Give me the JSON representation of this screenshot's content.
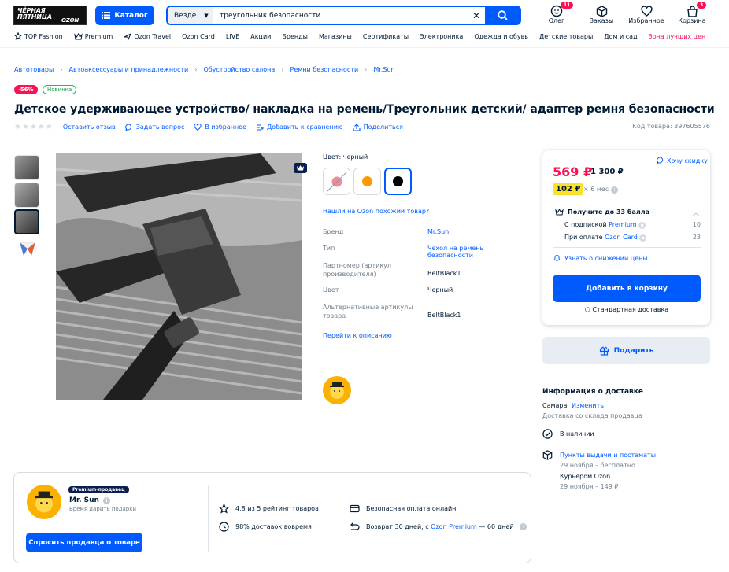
{
  "header": {
    "logo_line1": "ЧЁРНАЯ",
    "logo_line2": "ПЯТНИЦА",
    "logo_line3": "OZON",
    "catalog_label": "Каталог",
    "search_scope": "Везде",
    "search_query": "треугольник безопасности",
    "user_label": "Олег",
    "user_badge": "11",
    "orders_label": "Заказы",
    "favorites_label": "Избранное",
    "cart_label": "Корзина",
    "cart_badge": "3"
  },
  "topnav": [
    "TOP Fashion",
    "Premium",
    "Ozon Travel",
    "Ozon Card",
    "LIVE",
    "Акции",
    "Бренды",
    "Магазины",
    "Сертификаты",
    "Электроника",
    "Одежда и обувь",
    "Детские товары",
    "Дом и сад",
    "Зона лучших цен"
  ],
  "breadcrumbs": [
    "Автотовары",
    "Автоаксессуары и принадлежности",
    "Обустройство салона",
    "Ремни безопасности",
    "Mr.Sun"
  ],
  "chips": {
    "sale": "-56%",
    "new": "Новинка"
  },
  "product": {
    "title": "Детское удерживающее устройство/ накладка на ремень/Треугольник детский/ адаптер ремня безопасности",
    "code": "Код товара: 397605576",
    "actions": {
      "review": "Оставить отзыв",
      "question": "Задать вопрос",
      "favorite": "В избранное",
      "compare": "Добавить к сравнению",
      "share": "Поделиться"
    }
  },
  "options": {
    "color_label": "Цвет: черный",
    "similar_link": "Нашли на Ozon похожий товар?",
    "goto_description": "Перейти к описанию"
  },
  "specs": [
    {
      "key": "Бренд",
      "value": "Mr.Sun",
      "link": true
    },
    {
      "key": "Тип",
      "value": "Чехол на ремень безопасности",
      "link": true
    },
    {
      "key": "Партномер (артикул производителя)",
      "value": "BeltBlack1",
      "link": false
    },
    {
      "key": "Цвет",
      "value": "Черный",
      "link": false
    },
    {
      "key": "Альтернативные артикулы товара",
      "value": "BeltBlack1",
      "link": false
    }
  ],
  "price": {
    "current": "569 ₽",
    "old": "1 300 ₽",
    "want_discount": "Хочу скидку!",
    "installment": "102 ₽",
    "installment_terms": "× 6 мес",
    "points_title": "Получите до 33 балла",
    "points": [
      {
        "prefix": "С подпиской ",
        "link": "Premium",
        "value": "10"
      },
      {
        "prefix": "При оплате ",
        "link": "Ozon Card",
        "value": "23"
      }
    ],
    "notify": "Узнать о снижении цены",
    "cart_button": "Добавить в корзину",
    "delivery_type": "Стандартная доставка",
    "gift_button": "Подарить"
  },
  "delivery": {
    "title": "Информация о доставке",
    "city": "Самара",
    "change": "Изменить",
    "warehouse": "Доставка со склада продавца",
    "in_stock": "В наличии",
    "pickup_link": "Пункты выдачи и постаматы",
    "pickup_date": "29 ноября – бесплатно",
    "courier": "Курьером Ozon",
    "courier_date": "29 ноября – 149 ₽"
  },
  "seller": {
    "premium_badge": "Premium-продавец",
    "name": "Mr. Sun",
    "slogan": "Время дарить подарки",
    "ask_button": "Спросить продавца о товаре",
    "rating": "4,8 из 5 рейтинг товаров",
    "on_time": "98% доставок вовремя",
    "safe_payment": "Безопасная оплата онлайн",
    "return_prefix": "Возврат 30 дней, с ",
    "return_link": "Ozon Premium",
    "return_suffix": " — 60 дней"
  },
  "colors": {
    "brand": "#005bff",
    "sale": "#f91155",
    "installment": "#fbe12c",
    "text": "#001a34"
  }
}
